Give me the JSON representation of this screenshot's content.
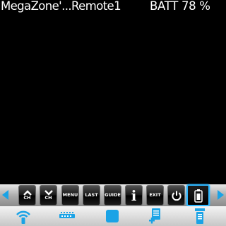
{
  "header": {
    "title": "MegaZone'...Remote1",
    "battery": "BATT 78 %"
  },
  "remote_keys": {
    "ch_up_label": "CH",
    "ch_down_label": "CH",
    "menu_label": "MENU",
    "last_label": "LAST",
    "guide_label": "GUIDE",
    "info_glyph": "i",
    "exit_label": "EXIT"
  },
  "colors": {
    "accent": "#1aa3e6",
    "selection": "#2fb7ff"
  },
  "icons": {
    "scroll_left": "triangle-left-icon",
    "scroll_right": "triangle-right-icon",
    "power": "power-icon",
    "remote": "remote-control-icon",
    "tabs": [
      "wifi-icon",
      "ir-blaster-icon",
      "display-icon",
      "add-device-icon",
      "device-list-icon"
    ]
  }
}
